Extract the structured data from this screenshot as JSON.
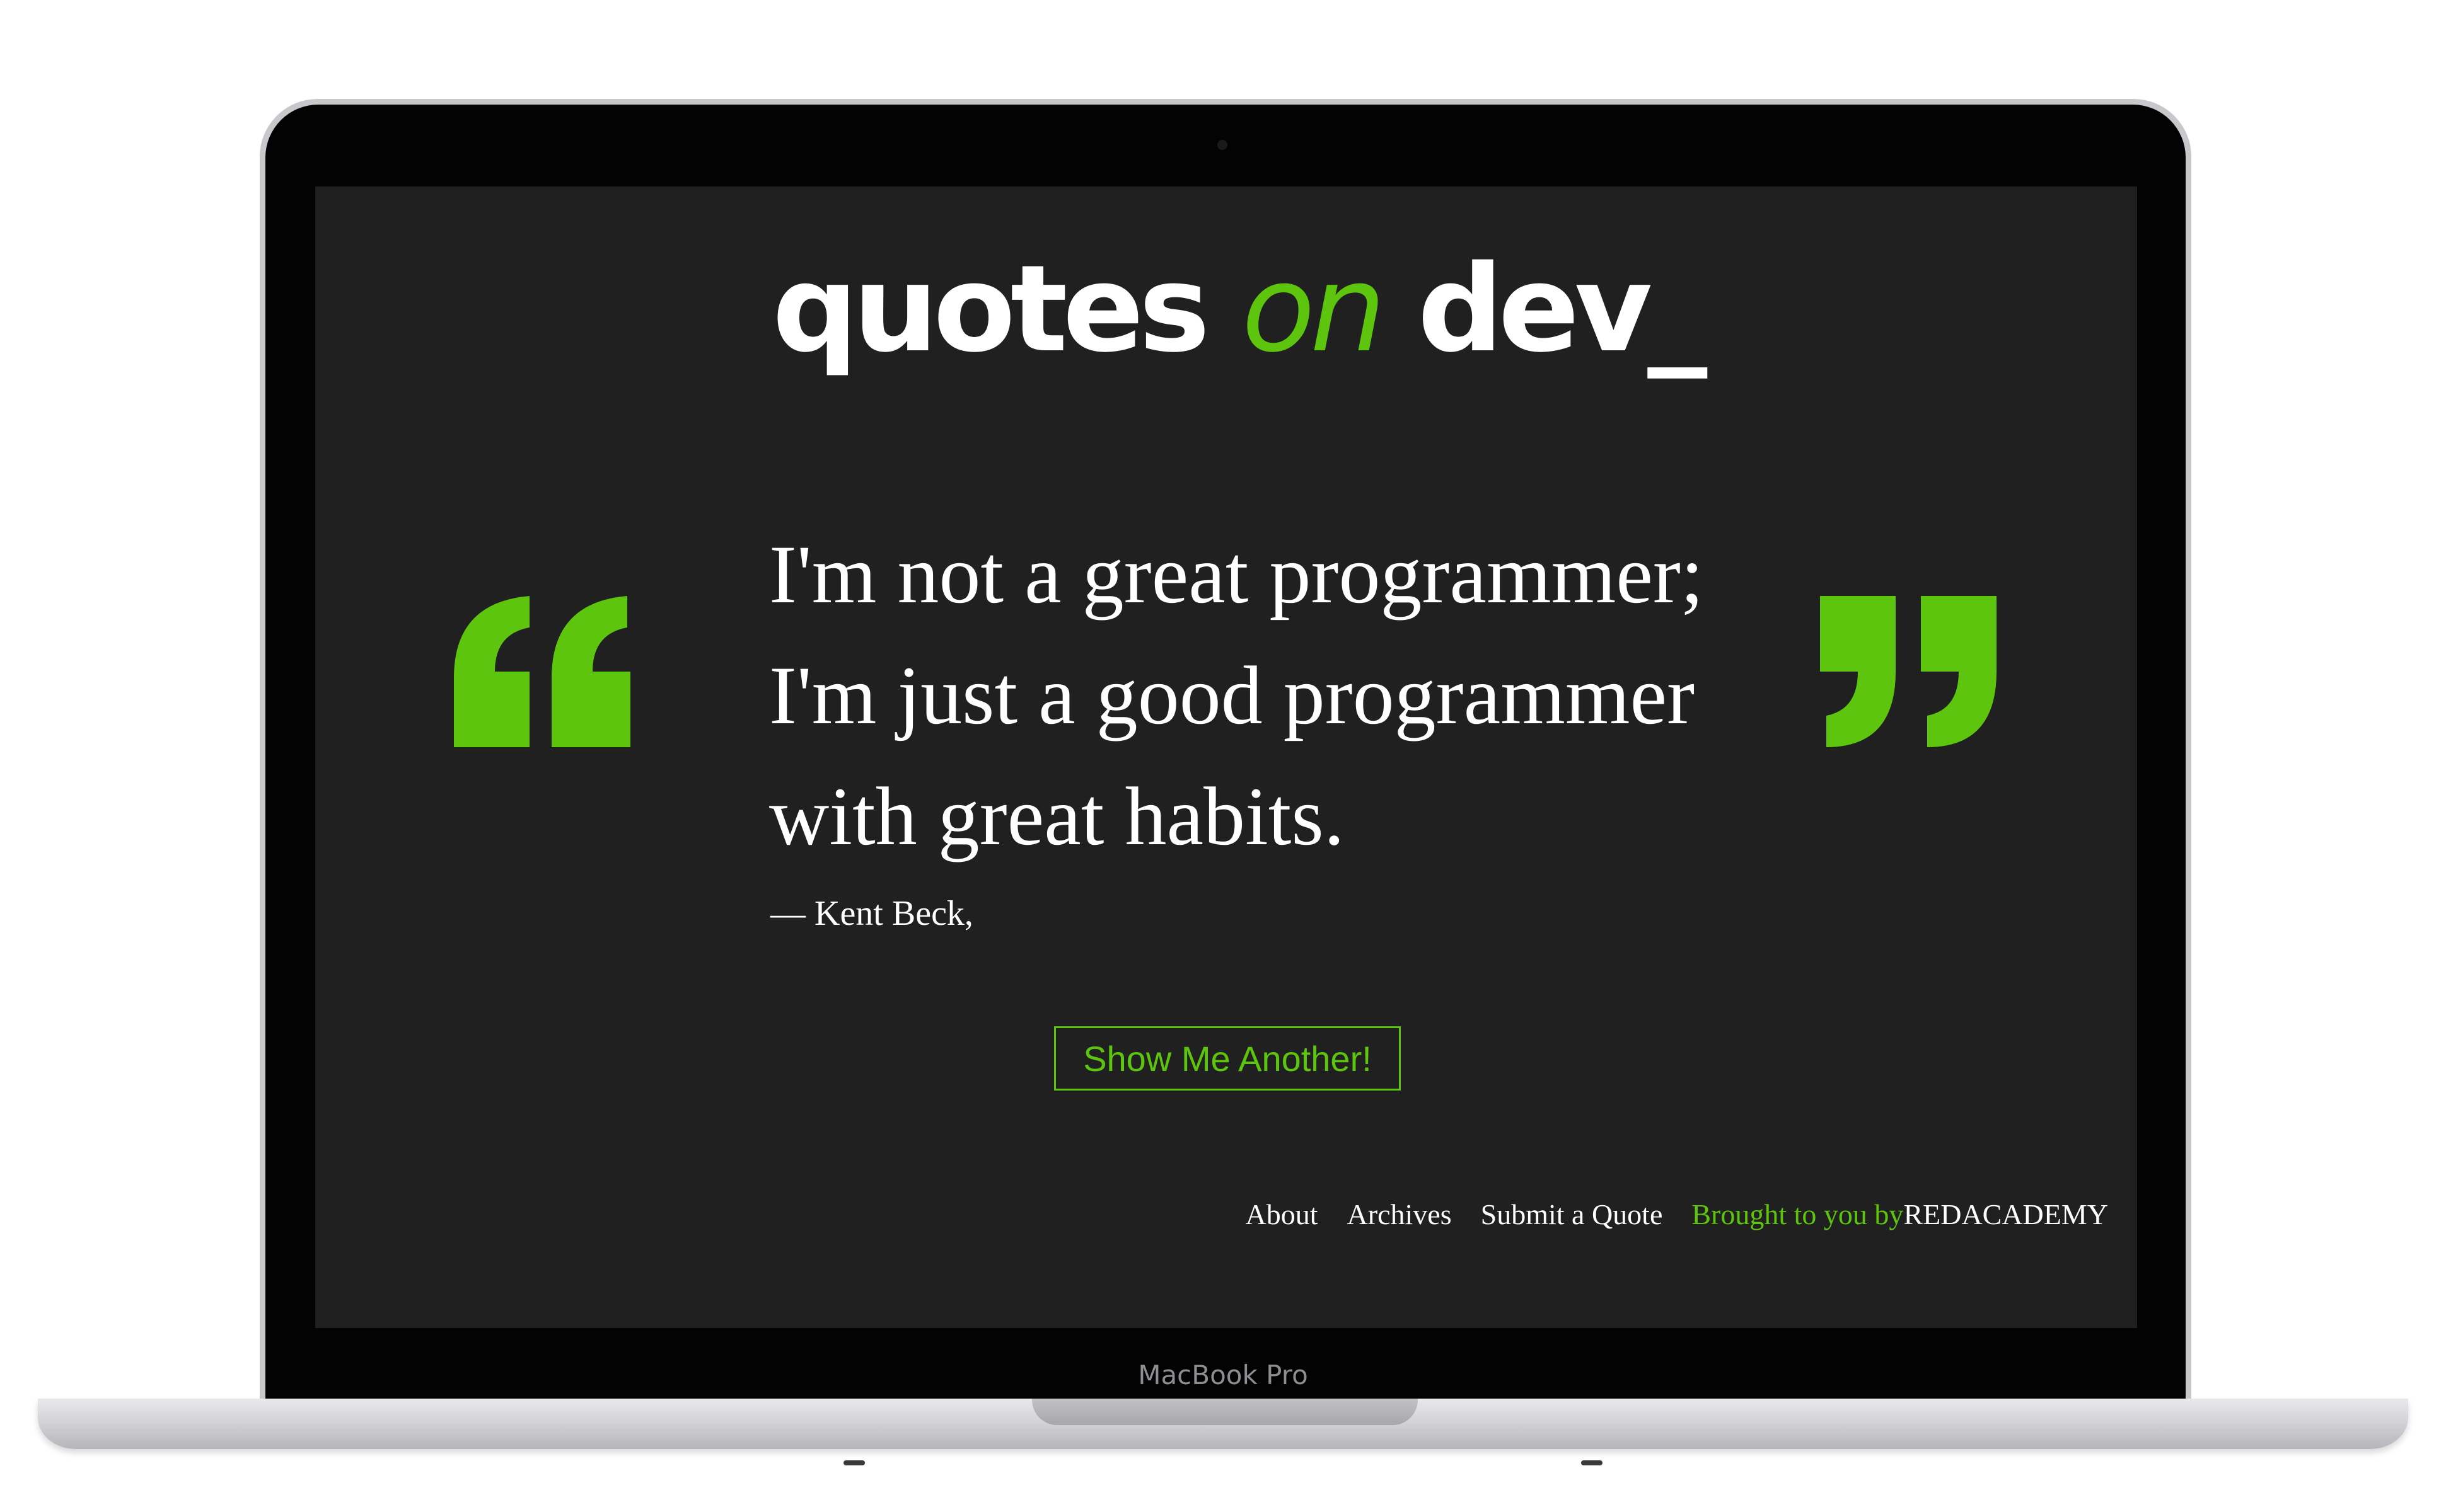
{
  "device": {
    "model_label": "MacBook Pro"
  },
  "site": {
    "logo": {
      "part1": "quotes ",
      "accent": "on",
      "part2": " dev_"
    },
    "accent_color": "#5dc50e",
    "background_color": "#202020"
  },
  "quote": {
    "text": "I'm not a great programmer; I'm just a good programmer with great habits.",
    "author": "— Kent Beck,"
  },
  "icons": {
    "open_quote": "open-quote-icon",
    "close_quote": "close-quote-icon"
  },
  "actions": {
    "show_another_label": "Show Me Another!"
  },
  "footer": {
    "links": [
      "About",
      "Archives",
      "Submit a Quote"
    ],
    "credit_prefix": "Brought to you by",
    "credit_brand": "REDACADEMY"
  }
}
